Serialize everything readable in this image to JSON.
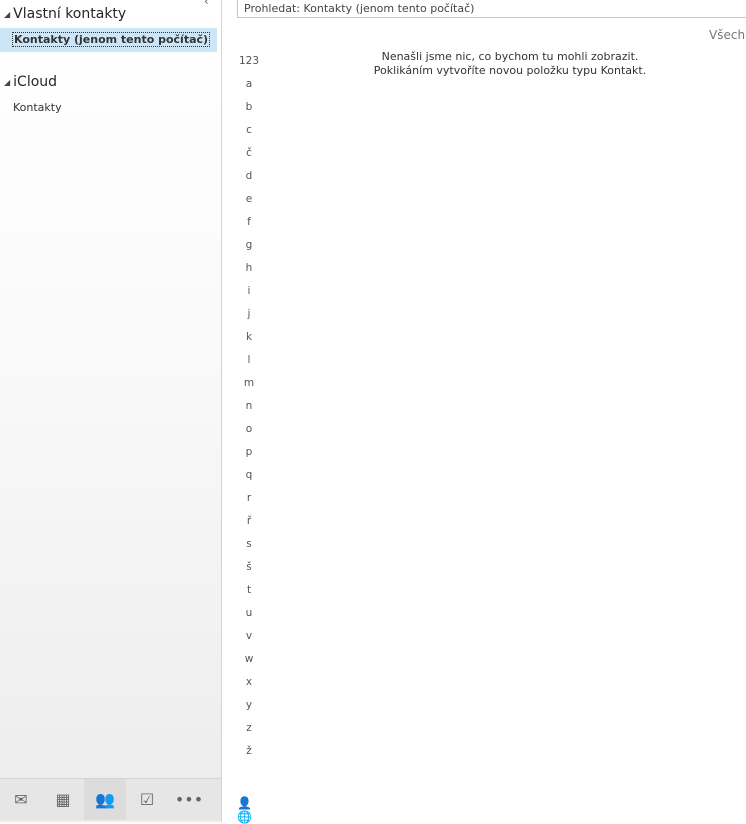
{
  "sidebar": {
    "groups": [
      {
        "label": "Vlastní kontakty",
        "folders": [
          "Kontakty (jenom tento počítač)"
        ]
      },
      {
        "label": "iCloud",
        "folders": [
          "Kontakty"
        ]
      }
    ],
    "nav": [
      "mail-icon",
      "calendar-icon",
      "people-icon",
      "tasks-icon",
      "more-icon"
    ]
  },
  "search": {
    "placeholder": "Prohledat: Kontakty (jenom tento počítač)"
  },
  "filter_label": "Všechn",
  "empty": {
    "line1": "Nenašli jsme nic, co bychom tu mohli zobrazit.",
    "line2": "Poklikáním vytvoříte novou položku typu Kontakt."
  },
  "letters": [
    "123",
    "a",
    "b",
    "c",
    "č",
    "d",
    "e",
    "f",
    "g",
    "h",
    "i",
    "j",
    "k",
    "l",
    "m",
    "n",
    "o",
    "p",
    "q",
    "r",
    "ř",
    "s",
    "š",
    "t",
    "u",
    "v",
    "w",
    "x",
    "y",
    "z",
    "ž"
  ],
  "accent": "#2a72c3"
}
